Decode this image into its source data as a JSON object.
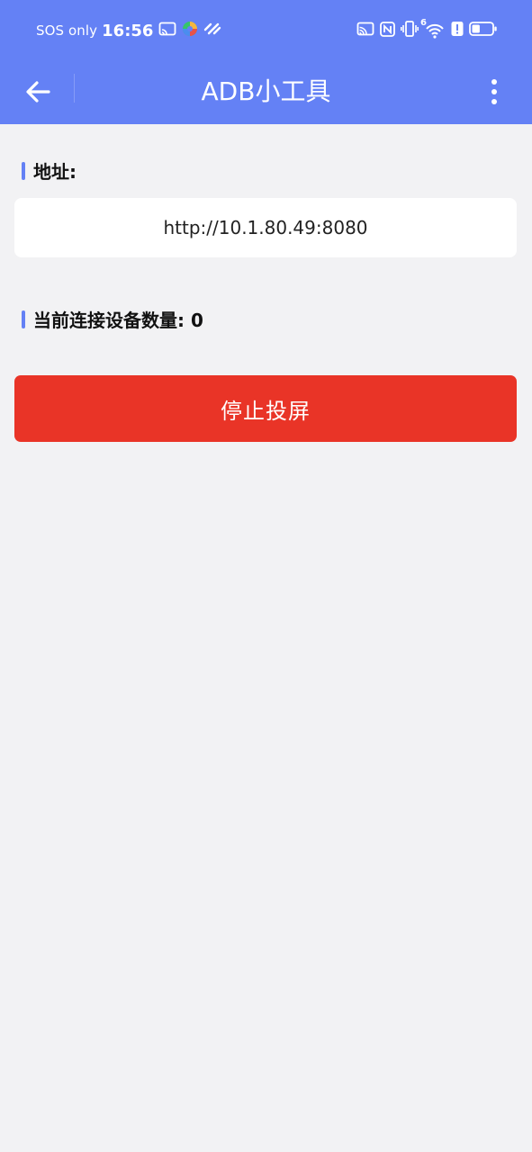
{
  "status_bar": {
    "carrier": "SOS only",
    "time": "16:56",
    "left_icons": [
      "cast-screen-icon",
      "colorful-app-icon",
      "slash-app-icon"
    ],
    "right_icons": [
      "cast-icon",
      "nfc-icon",
      "vibrate-icon",
      "wifi-6-icon",
      "alert-icon",
      "battery-icon"
    ],
    "wifi_superscript": "6",
    "battery_level": 0.4
  },
  "app_bar": {
    "title": "ADB小工具",
    "back_icon": "arrow-left-icon",
    "menu_icon": "more-vertical-icon"
  },
  "address": {
    "label": "地址:",
    "value": "http://10.1.80.49:8080"
  },
  "devices": {
    "label": "当前连接设备数量: 0"
  },
  "stop_button": {
    "label": "停止投屏"
  },
  "colors": {
    "primary": "#6481f5",
    "danger": "#e93427",
    "background": "#f2f2f4"
  }
}
